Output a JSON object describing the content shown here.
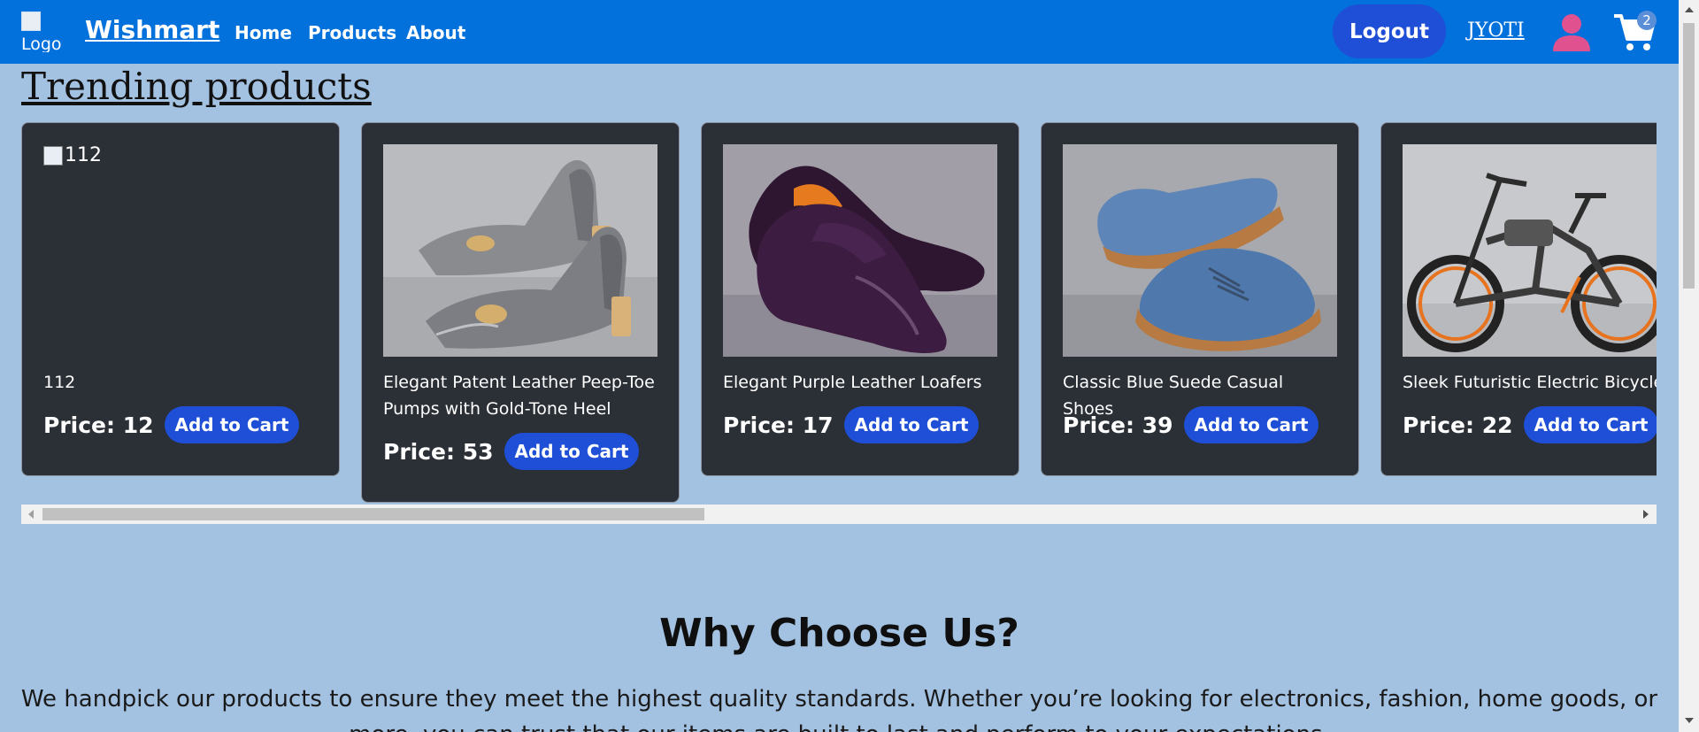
{
  "nav": {
    "logo_alt": "Logo",
    "brand": "Wishmart",
    "links": [
      "Home",
      "Products",
      "About"
    ],
    "logout_label": "Logout",
    "username": "JYOTI",
    "cart_count": "2",
    "user_icon": "user-icon",
    "cart_icon": "cart-icon"
  },
  "trending": {
    "title": "Trending products",
    "cards": [
      {
        "image_alt": "112",
        "name": "112",
        "price": "Price: 12",
        "button": "Add to Cart"
      },
      {
        "image": "sandals",
        "name": "Elegant Patent Leather Peep-Toe Pumps with Gold-Tone Heel",
        "price": "Price: 53",
        "button": "Add to Cart"
      },
      {
        "image": "loafers",
        "name": "Elegant Purple Leather Loafers",
        "price": "Price: 17",
        "button": "Add to Cart"
      },
      {
        "image": "suede-shoes",
        "name": "Classic Blue Suede Casual Shoes",
        "price": "Price: 39",
        "button": "Add to Cart"
      },
      {
        "image": "electric-bicycle",
        "name": "Sleek Futuristic Electric Bicycle",
        "price": "Price: 22",
        "button": "Add to Cart"
      }
    ]
  },
  "why": {
    "title": "Why Choose Us?",
    "text": "We handpick our products to ensure they meet the highest quality standards. Whether you’re looking for electronics, fashion, home goods, or more, you can trust that our items are built to last and perform to your expectations."
  },
  "colors": {
    "navbar": "#0371dc",
    "page_bg": "#a3c1e1",
    "card_bg": "#2b2f36",
    "button": "#1f4fd6",
    "user_icon": "#e0528f"
  }
}
